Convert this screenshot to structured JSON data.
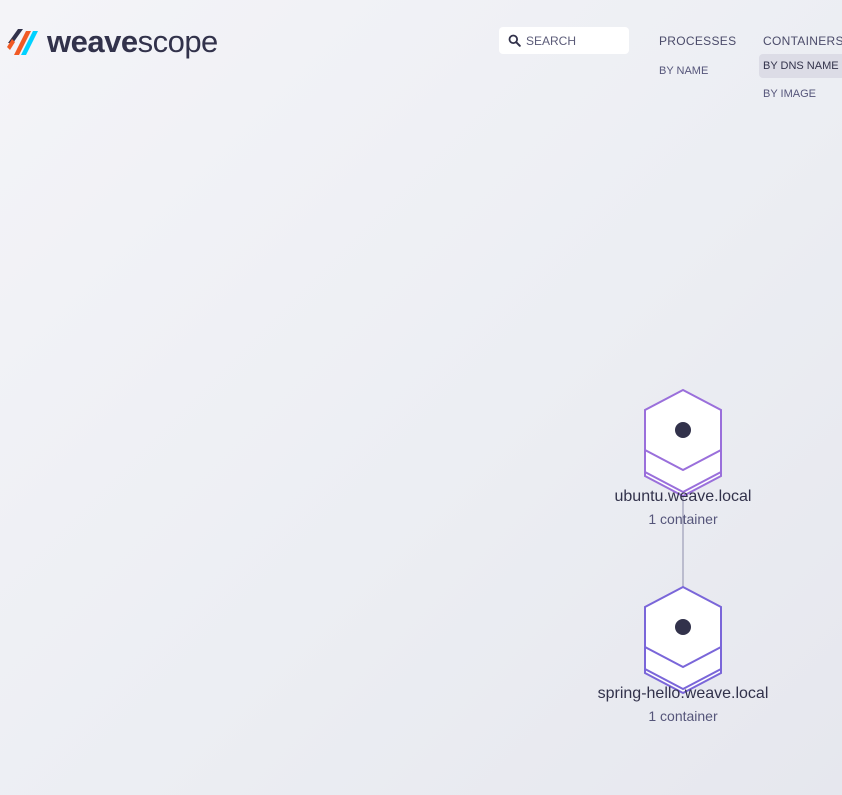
{
  "app": {
    "logo_weave": "weave",
    "logo_scope": "scope"
  },
  "search": {
    "placeholder": "SEARCH",
    "value": ""
  },
  "topologies": [
    {
      "label": "PROCESSES",
      "sub": [
        {
          "label": "BY NAME",
          "active": false
        }
      ]
    },
    {
      "label": "CONTAINERS",
      "sub": [
        {
          "label": "BY DNS NAME",
          "active": true
        },
        {
          "label": "BY IMAGE",
          "active": false
        }
      ]
    }
  ],
  "nodes": [
    {
      "label": "ubuntu.weave.local",
      "sublabel": "1 container"
    },
    {
      "label": "spring-hello.weave.local",
      "sublabel": "1 container"
    }
  ],
  "colors": {
    "node_outline": "#9a6fdb",
    "node_fill": "#ffffff",
    "node_dot": "#32324b",
    "edge": "#9c9cb6",
    "logo_orange": "#f15a24",
    "logo_blue": "#00d2ff",
    "logo_dark": "#32324b"
  }
}
